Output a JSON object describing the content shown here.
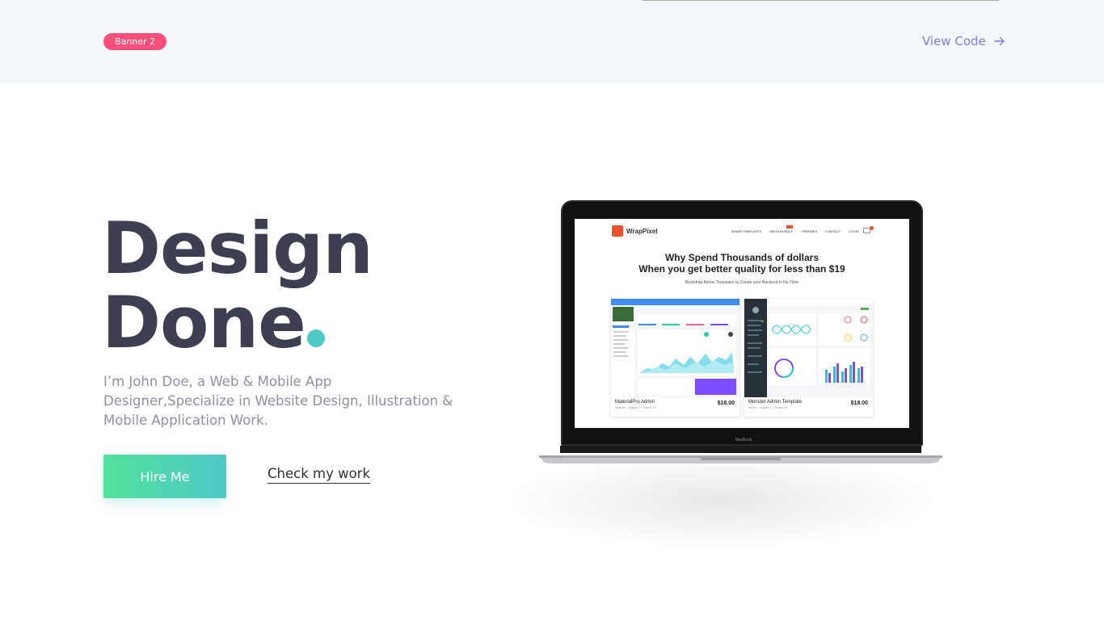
{
  "topbar": {
    "badge": "Banner 2",
    "view_code": "View Code",
    "arrow_icon": "arrow-right-icon",
    "badge_color": "#ff4f7b",
    "link_color": "#7f7fd6"
  },
  "hero": {
    "title_line1": "Design",
    "title_line2": "Done",
    "description": "I’m John Doe, a Web & Mobile App Designer,Specialize in Website Design, Illustration & Mobile Application Work.",
    "hire_button": "Hire Me",
    "check_work": "Check my work",
    "title_color": "#3b3f51",
    "dot_color": "#4fc8c8",
    "button_gradient": [
      "#52e29a",
      "#4fc8c8"
    ]
  },
  "laptop": {
    "brand_label": "MacBook",
    "screen": {
      "logo_text": "WrapPixel",
      "menu": [
        "ADMIN TEMPLATES",
        "MEGA BUNDLE",
        "FREEBIES",
        "CONTACT",
        "LOGIN"
      ],
      "headline_line1": "Why Spend Thousands of dollars",
      "headline_line2": "When you get better quality for less than $19",
      "subheadline": "Bootstrap Admin Templates to Create your Backend in No-Time",
      "products": [
        {
          "name": "MaterialPro Admin",
          "desc": "Material + Angular 7 + Starter Kit",
          "price": "$18.00"
        },
        {
          "name": "Monster Admin Template",
          "desc": "Admin + Angular 7 + Starter Kit",
          "price": "$18.00"
        }
      ]
    }
  }
}
